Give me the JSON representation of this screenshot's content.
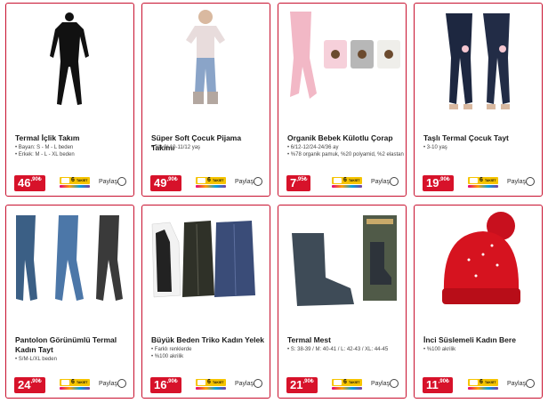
{
  "currency_symbol": "₺",
  "share_label": "Paylaş",
  "taksit_badge": {
    "count": "6",
    "text": "TAKSİT"
  },
  "colors": {
    "accent": "#c8102e",
    "price_bg": "#d7122a",
    "taksit_yellow": "#f6c400"
  },
  "products": [
    {
      "title": "Termal İçlik Takım",
      "features": [
        "Bayan: S - M - L beden",
        "Erkek: M - L - XL beden"
      ],
      "price_int": "46",
      "price_dec": ",90",
      "image_icon": "thermal-underwear-image"
    },
    {
      "title": "Süper Soft Çocuk Pijama Takımı",
      "features": [
        "7/8-9/ 10-11/12 yaş"
      ],
      "price_int": "49",
      "price_dec": ",90",
      "image_icon": "kids-pajama-image"
    },
    {
      "title": "Organik Bebek Külotlu Çorap",
      "features": [
        "6/12-12/24-24/36 ay",
        "%78 organik pamuk, %20 polyamid, %2 elastan"
      ],
      "price_int": "7",
      "price_dec": ",95",
      "image_icon": "baby-tights-image"
    },
    {
      "title": "Taşlı Termal Çocuk Tayt",
      "features": [
        "3-10 yaş"
      ],
      "price_int": "19",
      "price_dec": ",90",
      "image_icon": "kids-leggings-image"
    },
    {
      "title": "Pantolon Görünümlü Termal Kadın Tayt",
      "features": [
        "S/M-L/XL beden"
      ],
      "price_int": "24",
      "price_dec": ",90",
      "image_icon": "women-leggings-image"
    },
    {
      "title": "Büyük Beden Triko Kadın Yelek",
      "features": [
        "Farklı renklerde",
        "%100 akrilik"
      ],
      "price_int": "16",
      "price_dec": ",90",
      "image_icon": "knit-vest-image"
    },
    {
      "title": "Termal Mest",
      "features": [
        "S: 38-39 / M: 40-41 / L: 42-43 / XL: 44-45"
      ],
      "price_int": "21",
      "price_dec": ",90",
      "image_icon": "thermal-sock-image"
    },
    {
      "title": "İnci Süslemeli Kadın Bere",
      "features": [
        "%100 akrilik"
      ],
      "price_int": "11",
      "price_dec": ",90",
      "image_icon": "pearl-beanie-image"
    }
  ]
}
